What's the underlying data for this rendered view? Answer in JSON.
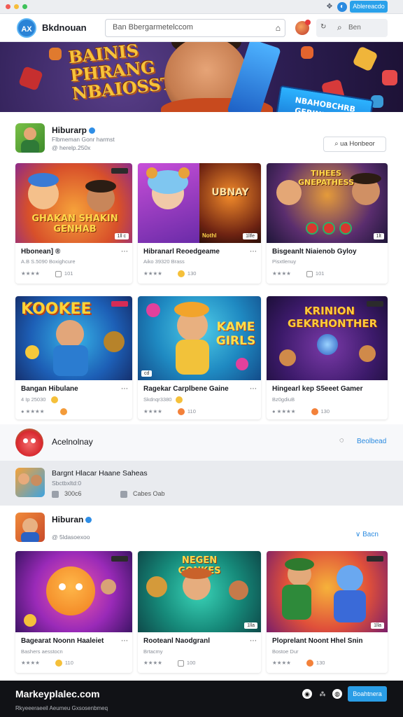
{
  "window": {
    "dots": [
      "#f15b55",
      "#f6be3b",
      "#3ec25a"
    ],
    "action_label": "Ablereacdo"
  },
  "header": {
    "logo_text": "AX",
    "brand": "Bkdnouan",
    "search_value": "Ban Bbergarmetelccom",
    "right_search_label": "Ben"
  },
  "banner": {
    "title": "BAINIS PHRANG NBAIOSST",
    "sign_text": "NBAHOBCHRB GEBINES HHE"
  },
  "section1": {
    "title": "Hiburarp",
    "sub1": "Flbmeman Gonr harmst",
    "sub2": "@ herelp.250x",
    "button_label": "ua Honbeor",
    "cards": [
      {
        "title": "Hbonean] ®",
        "meta": "A.B S.5090 Boxighcure",
        "stat_text": "101",
        "thumb_text": "GHAKAN SHAKIN GENHAB",
        "tag": "1ll c"
      },
      {
        "title": "Hibranarl Reoedgeame",
        "meta": "Aiko 39320 Brass",
        "stat_text": "130",
        "thumb_text": "UBNAY",
        "tag": "1llfe",
        "tag2": "Nothl"
      },
      {
        "title": "Bisgeanlt Niaienob Gyloy",
        "meta": "Pisxtlenuy",
        "stat_text": "101",
        "thumb_text": "TIHEES GNEPATHESS",
        "tag": "1lt"
      }
    ]
  },
  "section2": {
    "cards": [
      {
        "title": "Bangan Hibulane",
        "meta": "4 Ip 25030",
        "stat_text": "",
        "thumb_text": "KOOKEE",
        "tag": ""
      },
      {
        "title": "Ragekar Carplbene Gaine",
        "meta": "Skdnqr3380",
        "stat_text": "110",
        "thumb_text": "KAME GIRLS",
        "tag": "cd"
      },
      {
        "title": "Hingearl kep S5eeet Gamer",
        "meta": "Bz0gdiuB",
        "stat_text": "130",
        "thumb_text": "KRINION GEKRHONTHER",
        "tag": ""
      }
    ]
  },
  "row_apple": {
    "title": "Acelnolnay",
    "link": "Beolbead"
  },
  "row_highlight": {
    "title": "Bargnt Hlacar Haane Saheas",
    "sub": "Sbctbxltd:0",
    "stat1": "300c6",
    "stat2": "Cabes Oab"
  },
  "section3": {
    "title": "Hiburan",
    "sub": "@ 5ldasoexoo",
    "link": "Bacn",
    "cards": [
      {
        "title": "Bagearat Noonn Haaleiet",
        "meta": "Bashers aesstocn",
        "stat_text": "110",
        "thumb_text": "",
        "tag": ""
      },
      {
        "title": "Rooteanl Naodgranl",
        "meta": "Brtacmy",
        "stat_text": "100",
        "thumb_text": "NEGEN GONKES",
        "tag": "1lla"
      },
      {
        "title": "Ploprelant Noont Hhel Snin",
        "meta": "Bostoe Dur",
        "stat_text": "130",
        "thumb_text": "",
        "tag": "1lla"
      }
    ]
  },
  "footer": {
    "brand": "Markeyplalec.com",
    "sub": "Rkyeeeraeeil Aeumeu Gxsosenbmeq",
    "button_label": "Boahtnera"
  }
}
